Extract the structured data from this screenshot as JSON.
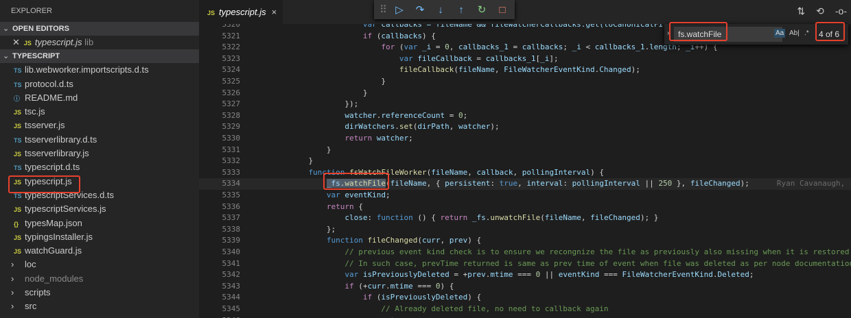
{
  "sidebar": {
    "title": "EXPLORER",
    "open_editors": "OPEN EDITORS",
    "open_file": {
      "icon": "JS",
      "name": "typescript.js",
      "dir": "lib"
    },
    "folder": "TYPESCRIPT",
    "files": [
      {
        "icon": "TS",
        "name": "lib.webworker.importscripts.d.ts",
        "t": "ts"
      },
      {
        "icon": "TS",
        "name": "protocol.d.ts",
        "t": "ts"
      },
      {
        "icon": "ⓘ",
        "name": "README.md",
        "t": "md"
      },
      {
        "icon": "JS",
        "name": "tsc.js",
        "t": "js"
      },
      {
        "icon": "JS",
        "name": "tsserver.js",
        "t": "js"
      },
      {
        "icon": "TS",
        "name": "tsserverlibrary.d.ts",
        "t": "ts"
      },
      {
        "icon": "JS",
        "name": "tsserverlibrary.js",
        "t": "js"
      },
      {
        "icon": "TS",
        "name": "typescript.d.ts",
        "t": "ts"
      },
      {
        "icon": "JS",
        "name": "typescript.js",
        "t": "js"
      },
      {
        "icon": "TS",
        "name": "typescriptServices.d.ts",
        "t": "ts"
      },
      {
        "icon": "JS",
        "name": "typescriptServices.js",
        "t": "js"
      },
      {
        "icon": "{}",
        "name": "typesMap.json",
        "t": "json"
      },
      {
        "icon": "JS",
        "name": "typingsInstaller.js",
        "t": "js"
      },
      {
        "icon": "JS",
        "name": "watchGuard.js",
        "t": "js"
      }
    ],
    "folders": [
      {
        "name": "loc",
        "dim": false
      },
      {
        "name": "node_modules",
        "dim": true
      },
      {
        "name": "scripts",
        "dim": false
      },
      {
        "name": "src",
        "dim": false
      }
    ]
  },
  "tab": {
    "icon": "JS",
    "label": "typescript.js",
    "close": "×"
  },
  "debug_toolbar": [
    {
      "name": "continue",
      "g": "▷",
      "c": "#75beff"
    },
    {
      "name": "step-over",
      "g": "↷",
      "c": "#75beff"
    },
    {
      "name": "step-into",
      "g": "↓",
      "c": "#75beff"
    },
    {
      "name": "step-out",
      "g": "↑",
      "c": "#75beff"
    },
    {
      "name": "restart",
      "g": "↻",
      "c": "#89d185"
    },
    {
      "name": "stop",
      "g": "□",
      "c": "#f48771"
    }
  ],
  "find": {
    "value": "fs.watchFile",
    "match_case": "Aa",
    "whole_word": "Ab|",
    "regex": ".*",
    "count": "4 of 6"
  },
  "blame": "Ryan Cavanaugh,",
  "lines": [
    {
      "n": "5320",
      "i": 24,
      "t": [
        [
          "var ",
          "k"
        ],
        [
          "callbacks = fileName && fileWatcherCallbacks.get(toCanonicalFi",
          "v"
        ]
      ]
    },
    {
      "n": "5321",
      "i": 24,
      "t": [
        [
          "if",
          "c"
        ],
        [
          " (",
          "p"
        ],
        [
          "callbacks",
          "v"
        ],
        [
          ") {",
          "p"
        ]
      ]
    },
    {
      "n": "5322",
      "i": 28,
      "t": [
        [
          "for",
          "c"
        ],
        [
          " (",
          "p"
        ],
        [
          "var ",
          "k"
        ],
        [
          "_i",
          "v"
        ],
        [
          " = ",
          "p"
        ],
        [
          "0",
          "n"
        ],
        [
          ", ",
          "p"
        ],
        [
          "callbacks_1",
          "v"
        ],
        [
          " = ",
          "p"
        ],
        [
          "callbacks",
          "v"
        ],
        [
          "; ",
          "p"
        ],
        [
          "_i",
          "v"
        ],
        [
          " < ",
          "p"
        ],
        [
          "callbacks_1",
          "v"
        ],
        [
          ".",
          "p"
        ],
        [
          "length",
          "v"
        ],
        [
          "; ",
          "p"
        ],
        [
          "_i",
          "v"
        ],
        [
          "++) {",
          "p"
        ]
      ]
    },
    {
      "n": "5323",
      "i": 32,
      "t": [
        [
          "var ",
          "k"
        ],
        [
          "fileCallback",
          "v"
        ],
        [
          " = ",
          "p"
        ],
        [
          "callbacks_1",
          "v"
        ],
        [
          "[",
          "p"
        ],
        [
          "_i",
          "v"
        ],
        [
          "];",
          "p"
        ]
      ]
    },
    {
      "n": "5324",
      "i": 32,
      "t": [
        [
          "fileCallback",
          "f"
        ],
        [
          "(",
          "p"
        ],
        [
          "fileName",
          "v"
        ],
        [
          ", ",
          "p"
        ],
        [
          "FileWatcherEventKind",
          "v"
        ],
        [
          ".",
          "p"
        ],
        [
          "Changed",
          "v"
        ],
        [
          ");",
          "p"
        ]
      ]
    },
    {
      "n": "5325",
      "i": 28,
      "t": [
        [
          "}",
          "p"
        ]
      ]
    },
    {
      "n": "5326",
      "i": 24,
      "t": [
        [
          "}",
          "p"
        ]
      ]
    },
    {
      "n": "5327",
      "i": 20,
      "t": [
        [
          "});",
          "p"
        ]
      ]
    },
    {
      "n": "5328",
      "i": 20,
      "t": [
        [
          "watcher",
          "v"
        ],
        [
          ".",
          "p"
        ],
        [
          "referenceCount",
          "v"
        ],
        [
          " = ",
          "p"
        ],
        [
          "0",
          "n"
        ],
        [
          ";",
          "p"
        ]
      ]
    },
    {
      "n": "5329",
      "i": 20,
      "t": [
        [
          "dirWatchers",
          "v"
        ],
        [
          ".",
          "p"
        ],
        [
          "set",
          "f"
        ],
        [
          "(",
          "p"
        ],
        [
          "dirPath",
          "v"
        ],
        [
          ", ",
          "p"
        ],
        [
          "watcher",
          "v"
        ],
        [
          ");",
          "p"
        ]
      ]
    },
    {
      "n": "5330",
      "i": 20,
      "t": [
        [
          "return ",
          "c"
        ],
        [
          "watcher",
          "v"
        ],
        [
          ";",
          "p"
        ]
      ]
    },
    {
      "n": "5331",
      "i": 16,
      "t": [
        [
          "}",
          "p"
        ]
      ]
    },
    {
      "n": "5332",
      "i": 12,
      "t": [
        [
          "}",
          "p"
        ]
      ]
    },
    {
      "n": "5333",
      "i": 12,
      "t": [
        [
          "function ",
          "k"
        ],
        [
          "fsWatchFileWorker",
          "f"
        ],
        [
          "(",
          "p"
        ],
        [
          "fileName",
          "v"
        ],
        [
          ", ",
          "p"
        ],
        [
          "callback",
          "v"
        ],
        [
          ", ",
          "p"
        ],
        [
          "pollingInterval",
          "v"
        ],
        [
          ") {",
          "p"
        ]
      ]
    },
    {
      "n": "5334",
      "i": 16,
      "cur": true,
      "t": [
        [
          "_fs",
          "v"
        ],
        [
          ".",
          "p"
        ],
        [
          "watchFile",
          "f"
        ],
        [
          "(",
          "p"
        ],
        [
          "fileName",
          "v"
        ],
        [
          ", { ",
          "p"
        ],
        [
          "persistent",
          "v"
        ],
        [
          ": ",
          "p"
        ],
        [
          "true",
          "k"
        ],
        [
          ", ",
          "p"
        ],
        [
          "interval",
          "v"
        ],
        [
          ": ",
          "p"
        ],
        [
          "pollingInterval",
          "v"
        ],
        [
          " || ",
          "p"
        ],
        [
          "250",
          "n"
        ],
        [
          " }, ",
          "p"
        ],
        [
          "fileChanged",
          "v"
        ],
        [
          ");",
          "p"
        ]
      ]
    },
    {
      "n": "5335",
      "i": 16,
      "t": [
        [
          "var ",
          "k"
        ],
        [
          "eventKind",
          "v"
        ],
        [
          ";",
          "p"
        ]
      ]
    },
    {
      "n": "5336",
      "i": 16,
      "t": [
        [
          "return",
          "c"
        ],
        [
          " {",
          "p"
        ]
      ]
    },
    {
      "n": "5337",
      "i": 20,
      "t": [
        [
          "close",
          "v"
        ],
        [
          ": ",
          "p"
        ],
        [
          "function",
          "k"
        ],
        [
          " () { ",
          "p"
        ],
        [
          "return ",
          "c"
        ],
        [
          "_fs",
          "v"
        ],
        [
          ".",
          "p"
        ],
        [
          "unwatchFile",
          "f"
        ],
        [
          "(",
          "p"
        ],
        [
          "fileName",
          "v"
        ],
        [
          ", ",
          "p"
        ],
        [
          "fileChanged",
          "v"
        ],
        [
          "); }",
          "p"
        ]
      ]
    },
    {
      "n": "5338",
      "i": 16,
      "t": [
        [
          "};",
          "p"
        ]
      ]
    },
    {
      "n": "5339",
      "i": 16,
      "t": [
        [
          "function ",
          "k"
        ],
        [
          "fileChanged",
          "f"
        ],
        [
          "(",
          "p"
        ],
        [
          "curr",
          "v"
        ],
        [
          ", ",
          "p"
        ],
        [
          "prev",
          "v"
        ],
        [
          ") {",
          "p"
        ]
      ]
    },
    {
      "n": "5340",
      "i": 20,
      "t": [
        [
          "// previous event kind check is to ensure we recongnize the file as previously also missing when it is restored",
          "m"
        ]
      ]
    },
    {
      "n": "5341",
      "i": 20,
      "t": [
        [
          "// In such case, prevTime returned is same as prev time of event when file was deleted as per node documentation",
          "m"
        ]
      ]
    },
    {
      "n": "5342",
      "i": 20,
      "t": [
        [
          "var ",
          "k"
        ],
        [
          "isPreviouslyDeleted",
          "v"
        ],
        [
          " = +",
          "p"
        ],
        [
          "prev",
          "v"
        ],
        [
          ".",
          "p"
        ],
        [
          "mtime",
          "v"
        ],
        [
          " === ",
          "p"
        ],
        [
          "0",
          "n"
        ],
        [
          " || ",
          "p"
        ],
        [
          "eventKind",
          "v"
        ],
        [
          " === ",
          "p"
        ],
        [
          "FileWatcherEventKind",
          "v"
        ],
        [
          ".",
          "p"
        ],
        [
          "Deleted",
          "v"
        ],
        [
          ";",
          "p"
        ]
      ]
    },
    {
      "n": "5343",
      "i": 20,
      "t": [
        [
          "if",
          "c"
        ],
        [
          " (+",
          "p"
        ],
        [
          "curr",
          "v"
        ],
        [
          ".",
          "p"
        ],
        [
          "mtime",
          "v"
        ],
        [
          " === ",
          "p"
        ],
        [
          "0",
          "n"
        ],
        [
          ") {",
          "p"
        ]
      ]
    },
    {
      "n": "5344",
      "i": 24,
      "t": [
        [
          "if",
          "c"
        ],
        [
          " (",
          "p"
        ],
        [
          "isPreviouslyDeleted",
          "v"
        ],
        [
          ") {",
          "p"
        ]
      ]
    },
    {
      "n": "5345",
      "i": 28,
      "t": [
        [
          "// Already deleted file, no need to callback again",
          "m"
        ]
      ]
    },
    {
      "n": "5346",
      "i": 28,
      "t": [
        [
          "return",
          "c"
        ],
        [
          ";",
          "p"
        ]
      ]
    }
  ]
}
